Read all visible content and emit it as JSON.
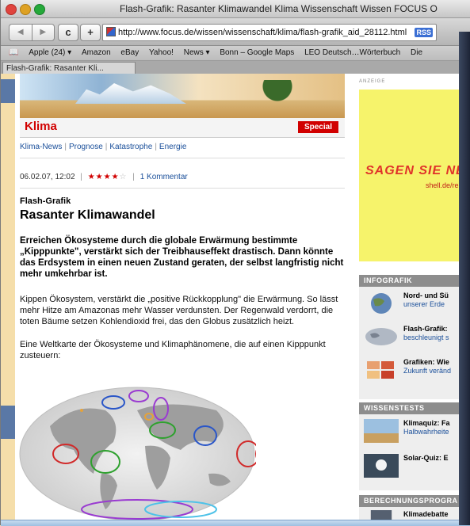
{
  "window": {
    "title": "Flash-Grafik: Rasanter Klimawandel Klima Wissenschaft Wissen FOCUS O"
  },
  "toolbar": {
    "back": "◀",
    "forward": "▶",
    "reload": "c",
    "add": "+",
    "url": "http://www.focus.de/wissen/wissenschaft/klima/flash-grafik_aid_28112.html",
    "rss": "RSS"
  },
  "bookmarks": [
    "Apple (24) ▾",
    "Amazon",
    "eBay",
    "Yahoo!",
    "News ▾",
    "Bonn – Google Maps",
    "LEO Deutsch…Wörterbuch",
    "Die"
  ],
  "tab": {
    "label": "Flash-Grafik: Rasanter Kli..."
  },
  "section": {
    "title": "Klima",
    "special": "Special"
  },
  "subnav": [
    "Klima-News",
    "Prognose",
    "Katastrophe",
    "Energie"
  ],
  "meta": {
    "date": "06.02.07, 12:02",
    "stars_on": "★★★★",
    "stars_off": "☆",
    "rating": 4,
    "comments": "1 Kommentar"
  },
  "article": {
    "kicker": "Flash-Grafik",
    "headline": "Rasanter Klimawandel",
    "lead": "Erreichen Ökosysteme durch die globale Erwärmung bestimmte „Kipppunkte\", verstärkt sich der Treibhauseffekt drastisch. Dann könnte das Erdsystem in einen neuen Zustand geraten, der selbst langfristig nicht mehr umkehrbar ist.",
    "body1": "Kippen Ökosystem, verstärkt die „positive Rückkopplung\" die Erwärmung. So lässt mehr Hitze am Amazonas mehr Wasser verdunsten. Der Regenwald verdorrt, die toten Bäume setzen Kohlendioxid frei, das den Globus zusätzlich heizt.",
    "body2": "Eine Weltkarte der Ökosysteme und Klimaphänomene, die auf einen Kipppunkt zusteuern:"
  },
  "sidebar": {
    "anzeige": "ANZEIGE",
    "ad_text": "SAGEN SIE NE",
    "ad_sub": "shell.de/re",
    "infografik": {
      "heading": "INFOGRAFIK",
      "items": [
        {
          "title": "Nord- und Sü",
          "sub": "unserer Erde"
        },
        {
          "title": "Flash-Grafik:",
          "sub": "beschleunigt s"
        },
        {
          "title": "Grafiken: Wie",
          "sub": "Zukunft veränd"
        }
      ]
    },
    "wissenstests": {
      "heading": "WISSENSTESTS",
      "items": [
        {
          "title": "Klimaquiz: Fa",
          "sub": "Halbwahrheite"
        },
        {
          "title": "Solar-Quiz: E",
          "sub": ""
        }
      ]
    },
    "berechnung": {
      "heading": "BERECHNUNGSPROGRA",
      "items": [
        {
          "title": "Klimadebatte",
          "sub": ""
        }
      ]
    }
  },
  "colors": {
    "accent_red": "#d10000",
    "link_blue": "#1a4f9a",
    "ad_yellow": "#f6f36b",
    "section_gray": "#8d8d8d",
    "page_tan": "#f5deaa"
  }
}
